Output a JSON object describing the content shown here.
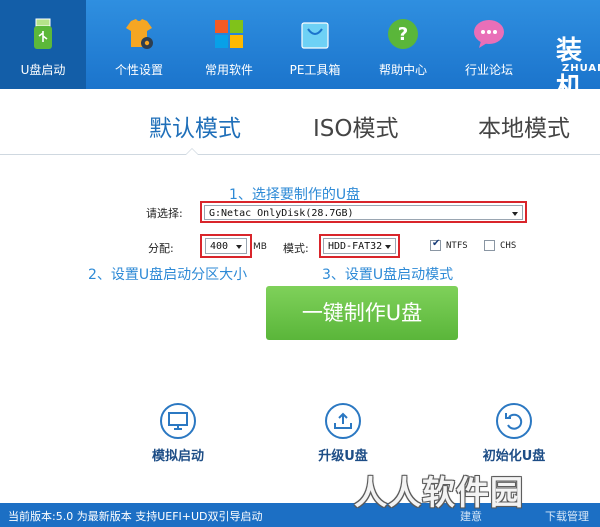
{
  "toolbar": {
    "items": [
      {
        "label": "U盘启动",
        "icon": "usb-drive-icon"
      },
      {
        "label": "个性设置",
        "icon": "shirt-gear-icon"
      },
      {
        "label": "常用软件",
        "icon": "apps-grid-icon"
      },
      {
        "label": "PE工具箱",
        "icon": "toolbox-bag-icon"
      },
      {
        "label": "帮助中心",
        "icon": "help-icon"
      },
      {
        "label": "行业论坛",
        "icon": "forum-chat-icon"
      }
    ],
    "brand": "装机",
    "brand_sub": "ZHUANG"
  },
  "modes": {
    "default": "默认模式",
    "iso": "ISO模式",
    "local": "本地模式"
  },
  "hints": {
    "step1": "1、选择要制作的U盘",
    "step2": "2、设置U盘启动分区大小",
    "step3": "3、设置U盘启动模式"
  },
  "form": {
    "select_label": "请选择:",
    "disk": "G:Netac OnlyDisk(28.7GB)",
    "partition_label": "分配:",
    "partition_value": "400",
    "partition_unit": "MB",
    "mode_label": "模式:",
    "mode_value": "HDD-FAT32",
    "ntfs_label": "NTFS",
    "ntfs_checked": true,
    "chs_label": "CHS",
    "chs_checked": false
  },
  "make_button": "一键制作U盘",
  "actions": {
    "simulate": "模拟启动",
    "upgrade": "升级U盘",
    "init": "初始化U盘"
  },
  "status": {
    "version": "当前版本:5.0 为最新版本 支持UEFI+UD双引导启动",
    "link1": "建意",
    "link2": "下载管理"
  },
  "watermark": "人人软件园",
  "colors": {
    "topbar": "#1f7ad2",
    "accent": "#2e8ad6",
    "make_button": "#62bd42",
    "highlight_box": "#d9252b"
  }
}
